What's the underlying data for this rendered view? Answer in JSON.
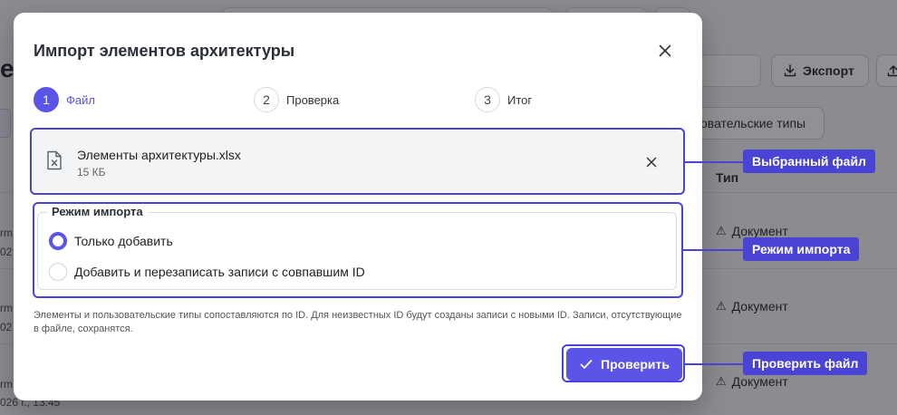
{
  "background": {
    "heading_fragment": "е",
    "export_label": "Экспорт",
    "types_label": "овательские типы",
    "col_type": "Тип",
    "rows": [
      {
        "left_top": "rm",
        "left_bottom": "02",
        "type": "Документ"
      },
      {
        "left_top": "rm",
        "left_bottom": "02",
        "type": "Документ"
      },
      {
        "left_top": "rm",
        "left_bottom": "026 г., 13:45",
        "type": "Документ"
      }
    ]
  },
  "modal": {
    "title": "Импорт элементов архитектуры",
    "steps": [
      {
        "num": "1",
        "label": "Файл",
        "active": true
      },
      {
        "num": "2",
        "label": "Проверка",
        "active": false
      },
      {
        "num": "3",
        "label": "Итог",
        "active": false
      }
    ],
    "file": {
      "name": "Элементы архитектуры.xlsx",
      "size": "15 КБ"
    },
    "import_mode": {
      "legend": "Режим импорта",
      "options": [
        {
          "label": "Только добавить",
          "checked": true
        },
        {
          "label": "Добавить и перезаписать записи с совпавшим ID",
          "checked": false
        }
      ]
    },
    "note": "Элементы и пользовательские типы сопоставляются по ID. Для неизвестных ID будут созданы записи с новыми ID. Записи, отсутствующие в файле, сохранятся.",
    "check_button": "Проверить"
  },
  "callouts": {
    "file": "Выбранный файл",
    "mode": "Режим импорта",
    "check": "Проверить файл"
  },
  "colors": {
    "accent": "#5b54e8",
    "highlight": "#4a44d6"
  }
}
